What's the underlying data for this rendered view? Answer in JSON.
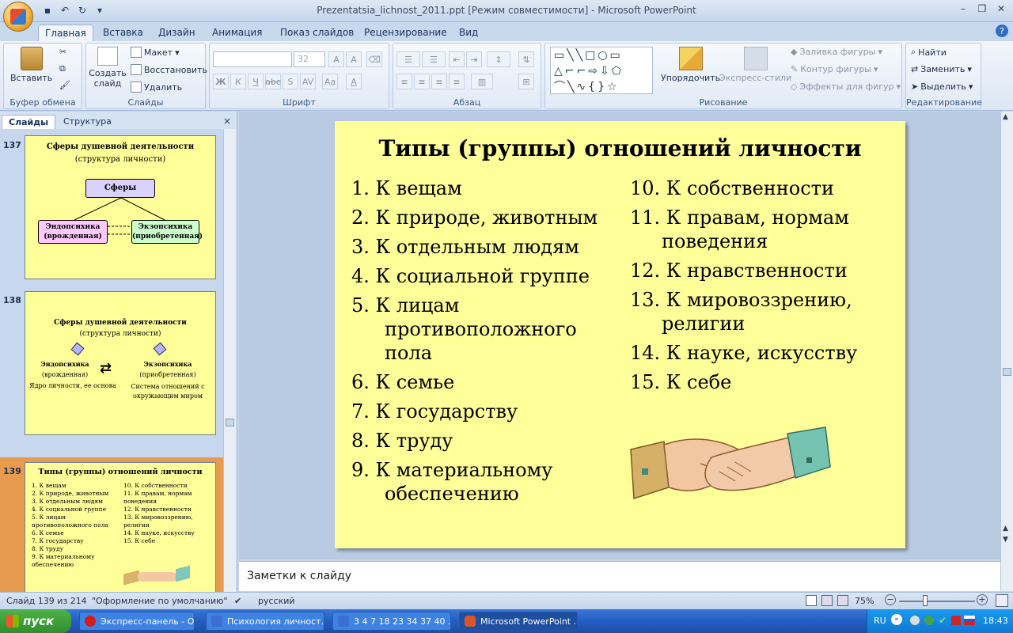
{
  "window": {
    "title": "Prezentatsia_lichnost_2011.ppt [Режим совместимости] - Microsoft PowerPoint"
  },
  "ribbon_tabs": [
    "Главная",
    "Вставка",
    "Дизайн",
    "Анимация",
    "Показ слайдов",
    "Рецензирование",
    "Вид"
  ],
  "ribbon": {
    "clipboard": {
      "paste": "Вставить",
      "label": "Буфер обмена"
    },
    "slides": {
      "create": "Создать слайд",
      "layout": "Макет",
      "reset": "Восстановить",
      "delete": "Удалить",
      "label": "Слайды"
    },
    "font": {
      "size": "32",
      "label": "Шрифт",
      "bold": "Ж",
      "italic": "К",
      "underline": "Ч"
    },
    "paragraph": {
      "label": "Абзац"
    },
    "drawing": {
      "arrange": "Упорядочить",
      "quick_styles": "Экспресс-стили",
      "fill": "Заливка фигуры",
      "outline": "Контур фигуры",
      "effects": "Эффекты для фигур",
      "label": "Рисование"
    },
    "editing": {
      "find": "Найти",
      "replace": "Заменить",
      "select": "Выделить",
      "label": "Редактирование"
    }
  },
  "panel": {
    "tabs": [
      "Слайды",
      "Структура"
    ],
    "close": "×"
  },
  "thumbnails": [
    {
      "number": "137",
      "title": "Сферы душевной деятельности",
      "subtitle": "(структура личности)",
      "box_top": "Сферы",
      "box_left": "Эндопсихика (врожденная)",
      "box_right": "Экзопсихика (приобретенная)"
    },
    {
      "number": "138",
      "title": "Сферы душевной деятельности",
      "subtitle": "(структура личности)",
      "left_title": "Эндопсихика",
      "left_sub": "(врожденная)",
      "left_desc": "Ядро личности, ее основа",
      "right_title": "Экзопсихика",
      "right_sub": "(приобретенная)",
      "right_desc": "Система отношений с окружающим миром"
    },
    {
      "number": "139",
      "title": "Типы (группы) отношений личности",
      "left_items": [
        "1. К вещам",
        "2. К природе, животным",
        "3. К отдельным людям",
        "4. К социальной группе",
        "5. К лицам противоположного пола",
        "6. К семье",
        "7. К государству",
        "8. К труду",
        "9. К материальному обеспечению"
      ],
      "right_items": [
        "10. К собственности",
        "11. К правам, нормам поведения",
        "12. К нравственности",
        "13. К мировоззрению, религии",
        "14. К науке, искусству",
        "15. К себе"
      ]
    }
  ],
  "slide": {
    "title": "Типы (группы) отношений личности",
    "left_items": [
      {
        "num": "1.",
        "text": "К вещам"
      },
      {
        "num": "2.",
        "text": "К природе, животным"
      },
      {
        "num": "3.",
        "text": "К отдельным людям"
      },
      {
        "num": "4.",
        "text": "К социальной группе"
      },
      {
        "num": "5.",
        "text": "К лицам",
        "cont": [
          "противоположного",
          "пола"
        ]
      },
      {
        "num": "6.",
        "text": "К семье"
      },
      {
        "num": "7.",
        "text": "К государству"
      },
      {
        "num": "8.",
        "text": "К труду"
      },
      {
        "num": "9.",
        "text": "К материальному",
        "cont": [
          "обеспечению"
        ]
      }
    ],
    "right_items": [
      {
        "num": "10.",
        "text": "К собственности"
      },
      {
        "num": "11.",
        "text": "К правам, нормам",
        "cont": [
          "поведения"
        ]
      },
      {
        "num": "12.",
        "text": "К нравственности"
      },
      {
        "num": "13.",
        "text": "К мировоззрению,",
        "cont": [
          "религии"
        ]
      },
      {
        "num": "14.",
        "text": "К науке, искусству"
      },
      {
        "num": "15.",
        "text": "К себе"
      }
    ]
  },
  "notes_placeholder": "Заметки к слайду",
  "status": {
    "slide_counter": "Слайд 139 из 214",
    "theme": "\"Оформление по умолчанию\"",
    "language": "русский",
    "zoom": "75%"
  },
  "taskbar": {
    "start": "пуск",
    "tasks": [
      "Экспресс-панель - О...",
      "Психология личност...",
      "3 4 7 18 23 34 37 40 ...",
      "Microsoft PowerPoint ..."
    ],
    "lang": "RU",
    "clock": "18:43"
  }
}
